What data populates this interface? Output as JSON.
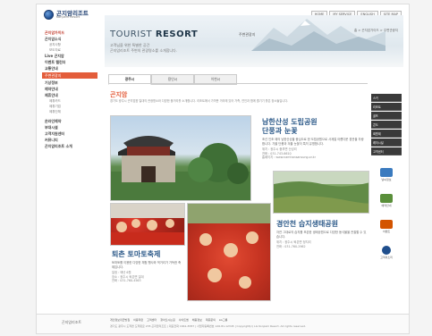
{
  "header": {
    "logo_kr": "곤지암리조트",
    "logo_en": "Konjiam Resort",
    "topnav": [
      "HOME",
      "MY SERVICE",
      "ENGLISH",
      "SITE MAP"
    ],
    "hero_title_plain": "TOURIST ",
    "hero_title_bold": "RESORT",
    "hero_tag": "주변관광지",
    "hero_sub1": "고객님을 위한 특별한 공간",
    "hero_sub2": "곤지암리조트 주변의 관광명소를 소개합니다.",
    "breadcrumb": "홈 > 곤지암가이드 > 주변관광지"
  },
  "leftnav": {
    "section_title": "곤지암가이드",
    "items": [
      {
        "label": "곤지암소식",
        "kind": "top"
      },
      {
        "label": "공지사항",
        "kind": "sub"
      },
      {
        "label": "보도자료",
        "kind": "sub"
      },
      {
        "label": "Live 곤지암",
        "kind": "top"
      },
      {
        "label": "이벤트 캘린더",
        "kind": "top"
      },
      {
        "label": "교통안내",
        "kind": "top"
      },
      {
        "label": "주변관광지",
        "kind": "active"
      },
      {
        "label": "기상정보",
        "kind": "top"
      },
      {
        "label": "예약안내",
        "kind": "top"
      },
      {
        "label": "제휴안내",
        "kind": "top"
      },
      {
        "label": "제휴카드",
        "kind": "sub"
      },
      {
        "label": "제휴기업",
        "kind": "sub"
      },
      {
        "label": "제휴단체",
        "kind": "sub"
      }
    ],
    "sections": [
      "온라인예약",
      "부대시설",
      "고객지원센터",
      "커뮤니티",
      "곤지암리조트 소개"
    ]
  },
  "tabs": [
    "광주시",
    "용인시",
    "이천시"
  ],
  "section": {
    "title": "곤지암",
    "desc": "경기도 광주시 곤지암읍 일대의 관광명소와 다양한 볼거리를 소개합니다. 리조트에서 가까운 거리에 있어 가족, 연인과 함께 즐기기 좋은 장소들입니다."
  },
  "attractions": [
    {
      "name": "남한산성 도립공원\n단풍과 눈꽃",
      "desc": "조선 인조 때의 남한산성을 중심으로 한 도립공원으로 사계절 아름다운 경관을 자랑합니다. 가을 단풍과 겨울 눈꽃이 특히 유명합니다.",
      "info": "위치 : 광주시 중부면 산성리\n전화 : 031-743-6610\n홈페이지 : www.namhansansung.or.kr"
    },
    {
      "name": "퇴촌 토마토축제",
      "desc": "토마토를 이용한 다양한 체험 행사와 먹거리가 가득한 축제입니다.",
      "info": "일정 : 매년 6월\n장소 : 광주시 퇴촌면 일대\n전화 : 031-760-4563"
    },
    {
      "name": "경안천 습지생태공원",
      "desc": "자연 그대로의 습지를 보존한 생태공원으로 다양한 동식물을 관찰할 수 있습니다.",
      "info": "위치 : 광주시 퇴촌면 정지리\n전화 : 031-760-2962"
    }
  ],
  "rail": {
    "buttons": [
      "스키",
      "리조트",
      "골프",
      "콘도",
      "회원제",
      "레저시설",
      "고객센터"
    ],
    "icons": [
      {
        "label": "날씨정보",
        "color": "#3b7bbf"
      },
      {
        "label": "예약안내",
        "color": "#5a8f3a"
      },
      {
        "label": "이벤트",
        "color": "#d35400"
      },
      {
        "label": "고객의소리",
        "color": "#1f4e8c"
      }
    ]
  },
  "footer": {
    "logo": "곤지암리조트",
    "links": [
      "개인정보취급방침",
      "이용약관",
      "고객센터",
      "찾아오시는길",
      "사이트맵",
      "채용정보",
      "제휴문의",
      "LG그룹"
    ],
    "address": "경기도 광주시 도척면 도척윗로 278 곤지암리조트 | 대표전화 1661-8787 | 사업자등록번호 126-81-12345 | Copyright(c) LG Konjiam Resort. All rights reserved."
  },
  "colors": {
    "accent": "#e35d3b",
    "title_blue": "#2e5b8a",
    "rail_dark": "#3a3a3a"
  }
}
